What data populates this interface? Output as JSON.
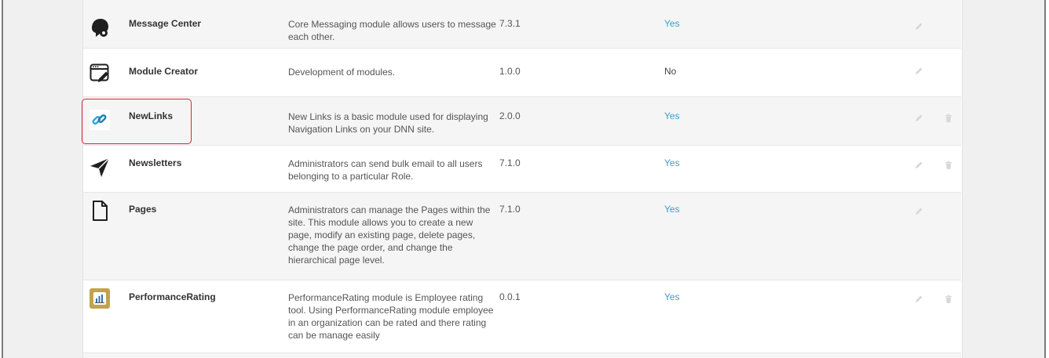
{
  "modules": [
    {
      "name": "Message Center",
      "description": "Core Messaging module allows users to message each other.",
      "version": "7.3.1",
      "flag": "Yes",
      "icon": "message-center-icon",
      "deletable": false
    },
    {
      "name": "Module Creator",
      "description": "Development of modules.",
      "version": "1.0.0",
      "flag": "No",
      "icon": "module-creator-icon",
      "deletable": false
    },
    {
      "name": "NewLinks",
      "description": "New Links is a basic module used for displaying Navigation Links on your DNN site.",
      "version": "2.0.0",
      "flag": "Yes",
      "icon": "link-icon",
      "deletable": true
    },
    {
      "name": "Newsletters",
      "description": "Administrators can send bulk email to all users belonging to a particular Role.",
      "version": "7.1.0",
      "flag": "Yes",
      "icon": "paper-plane-icon",
      "deletable": true
    },
    {
      "name": "Pages",
      "description": "Administrators can manage the Pages within the site. This module allows you to create a new page, modify an existing page, delete pages, change the page order, and change the hierarchical page level.",
      "version": "7.1.0",
      "flag": "Yes",
      "icon": "page-icon",
      "deletable": false
    },
    {
      "name": "PerformanceRating",
      "description": "PerformanceRating module is Employee rating tool. Using PerformanceRating module employee in an organization can be rated and there rating can be manage easily",
      "version": "0.0.1",
      "flag": "Yes",
      "icon": "performance-rating-icon",
      "deletable": true
    }
  ],
  "colors": {
    "yes": "#3d9cc7",
    "highlight": "#e0232a",
    "row_alt": "#f5f5f5"
  }
}
